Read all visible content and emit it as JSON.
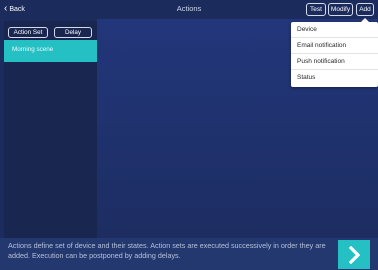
{
  "nav": {
    "back_label": "Back",
    "title": "Actions",
    "test_label": "Test",
    "modify_label": "Modify",
    "add_label": "Add"
  },
  "sidebar": {
    "segments": [
      "Action Set",
      "Delay"
    ],
    "items": [
      {
        "label": "Morning scene",
        "selected": true
      }
    ]
  },
  "add_menu": {
    "options": [
      "Device",
      "Email notification",
      "Push notification",
      "Status"
    ]
  },
  "footer": {
    "description": "Actions define set of device and their states. Action sets are executed successively in order they are added. Execution can be postponed by adding delays.",
    "next_icon": "chevron-right-icon"
  },
  "colors": {
    "accent": "#25c0c4",
    "background": "#1c2c5e",
    "sidebar": "#192650"
  }
}
